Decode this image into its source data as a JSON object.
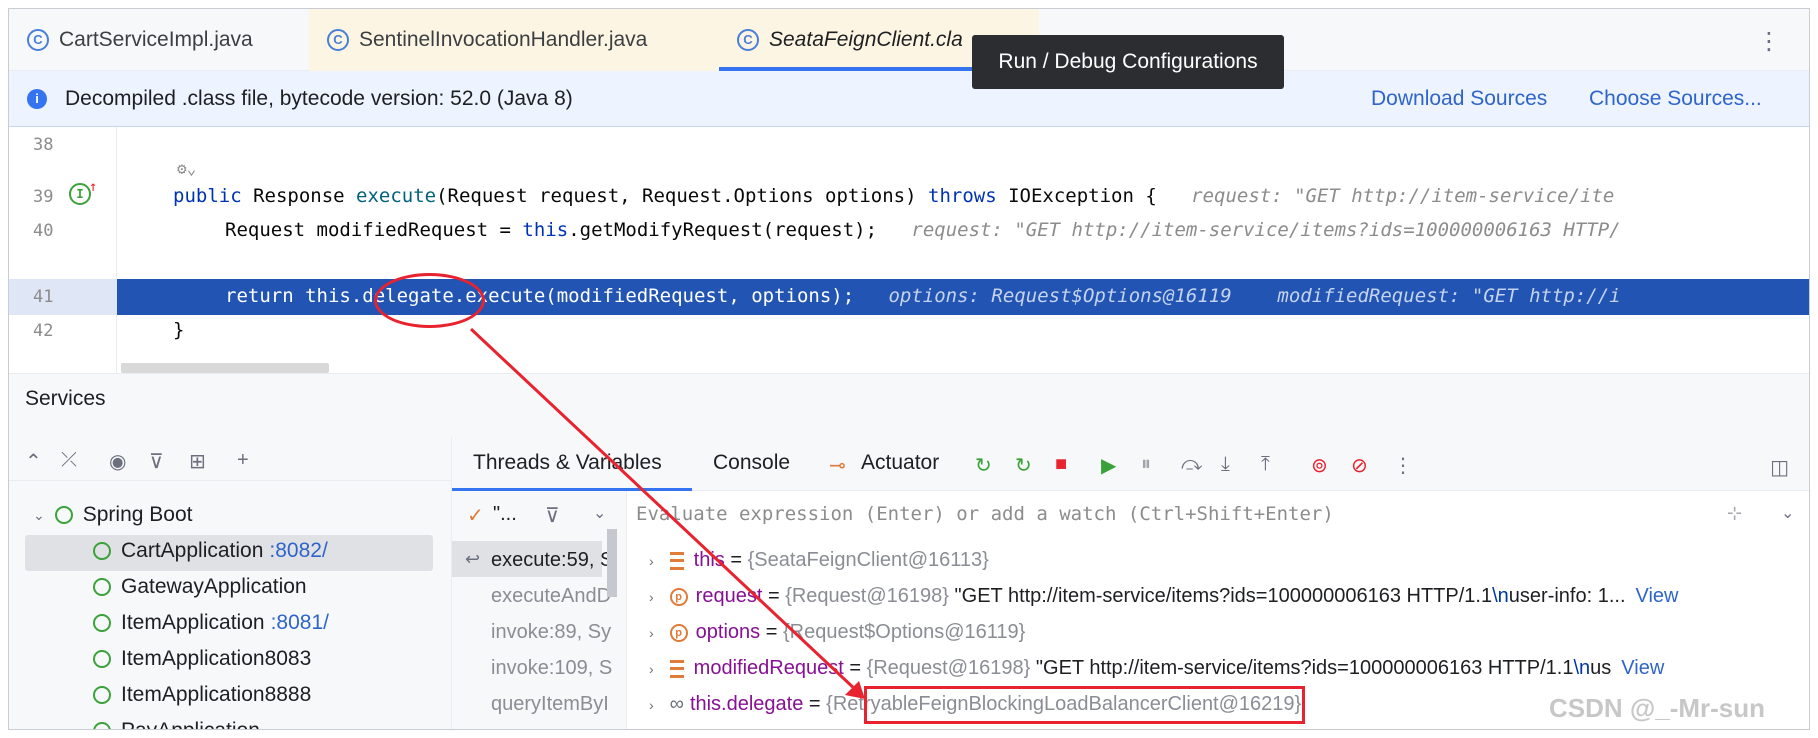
{
  "tabs": [
    {
      "label": "CartServiceImpl.java"
    },
    {
      "label": "SentinelInvocationHandler.java"
    },
    {
      "label": "SeataFeignClient.cla"
    }
  ],
  "tooltip": "Run / Debug Configurations",
  "banner": {
    "text": "Decompiled .class file, bytecode version: 52.0 (Java 8)",
    "download_sources": "Download Sources",
    "choose_sources": "Choose Sources..."
  },
  "editor": {
    "lines": [
      {
        "num": "38"
      },
      {
        "num": "39",
        "kw1": "public",
        "t1": " Response ",
        "fn": "execute",
        "t2": "(Request request, Request.Options options) ",
        "kw2": "throws",
        "t3": " IOException {",
        "hint": "request: \"GET http://item-service/ite"
      },
      {
        "num": "40",
        "t1": "Request modifiedRequest = ",
        "kw1": "this",
        "t2": ".getModifyRequest(request);",
        "hint": "request: \"GET http://item-service/items?ids=100000006163 HTTP/"
      },
      {
        "num": "41",
        "code": "return this.delegate.execute(modifiedRequest, options);",
        "hint1": "options: Request$Options@16119",
        "hint2": "modifiedRequest: \"GET http://i"
      },
      {
        "num": "42",
        "code": "}"
      }
    ]
  },
  "services": {
    "title": "Services",
    "tree": [
      {
        "label": "Spring Boot"
      },
      {
        "label": "CartApplication",
        "port": ":8082/"
      },
      {
        "label": "GatewayApplication"
      },
      {
        "label": "ItemApplication",
        "port": ":8081/"
      },
      {
        "label": "ItemApplication8083"
      },
      {
        "label": "ItemApplication8888"
      },
      {
        "label": "PayApplication"
      }
    ]
  },
  "debug": {
    "tabs": {
      "threads": "Threads & Variables",
      "console": "Console",
      "actuator": "Actuator"
    },
    "thread_filter": "\"...",
    "eval_placeholder": "Evaluate expression (Enter) or add a watch (Ctrl+Shift+Enter)",
    "frames": [
      "execute:59, S",
      "executeAndD",
      "invoke:89, Sy",
      "invoke:109, S",
      "queryItemByI"
    ],
    "variables": [
      {
        "name": "this",
        "value": "{SeataFeignClient@16113}"
      },
      {
        "name": "request",
        "type": "{Request@16198}",
        "value_a": "\"GET http://item-service/items?ids=100000006163 HTTP/1.1",
        "esc": "\\n",
        "value_b": "user-info: 1...",
        "link": "View"
      },
      {
        "name": "options",
        "type": "{Request$Options@16119}"
      },
      {
        "name": "modifiedRequest",
        "type": "{Request@16198}",
        "value_a": "\"GET http://item-service/items?ids=100000006163 HTTP/1.1",
        "esc": "\\n",
        "value_b": "us",
        "link": "View"
      },
      {
        "name": "this.delegate",
        "value_a": "{RetryableFeignBlockingLoadBalancerClient",
        "value_b": "@16219}"
      }
    ]
  },
  "watermark": "CSDN @_-Mr-sun"
}
